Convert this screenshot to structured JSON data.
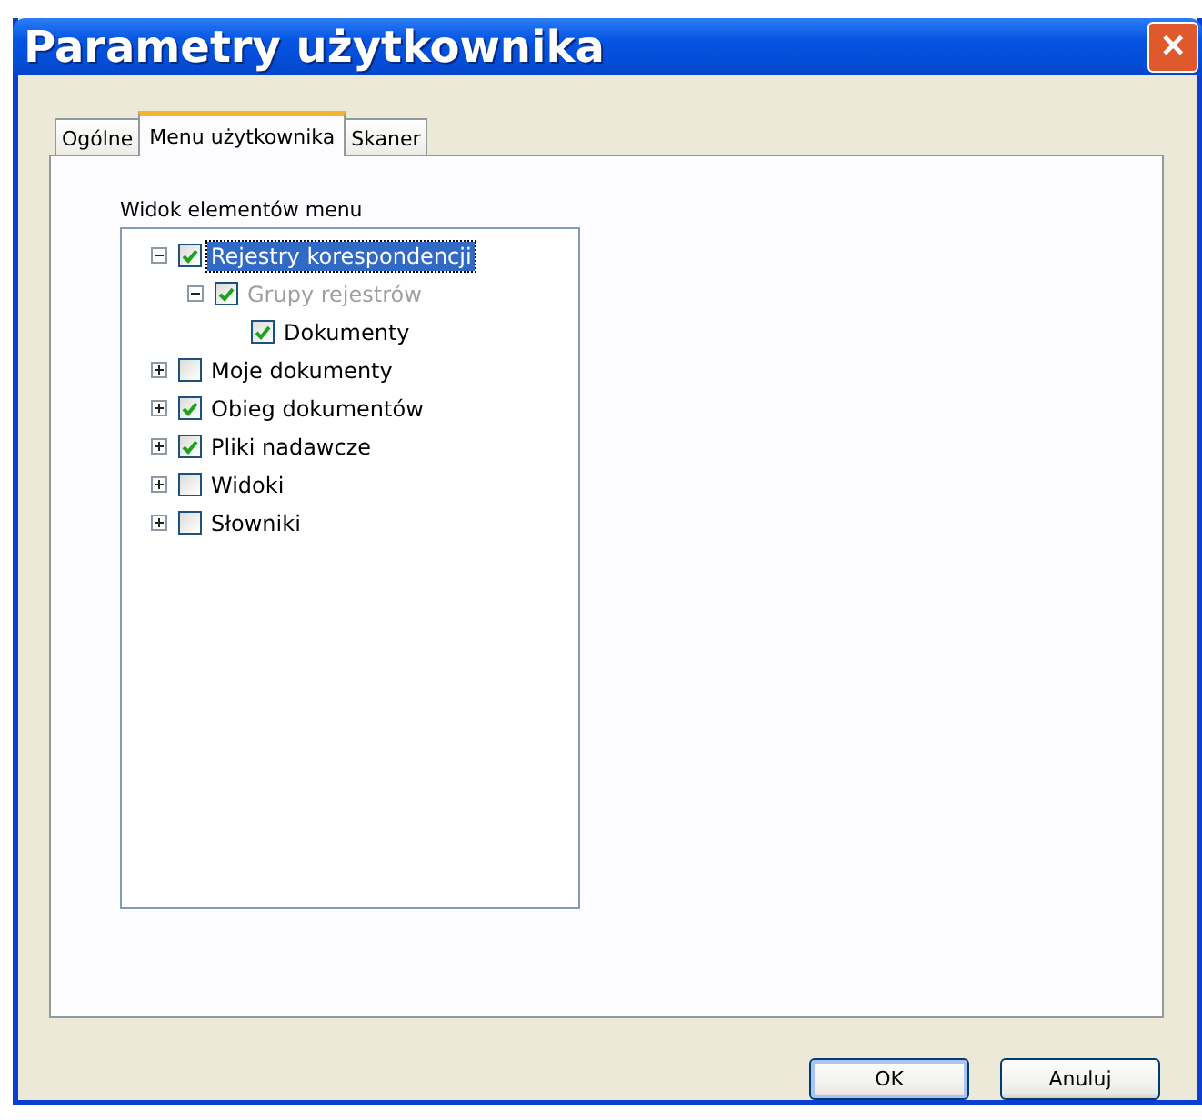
{
  "window": {
    "title": "Parametry użytkownika",
    "close": "✕"
  },
  "tabs": [
    {
      "label": "Ogólne",
      "selected": false
    },
    {
      "label": "Menu użytkownika",
      "selected": true
    },
    {
      "label": "Skaner",
      "selected": false
    }
  ],
  "tree": {
    "label": "Widok elementów menu",
    "items": [
      {
        "label": "Rejestry korespondencji",
        "checked": true,
        "selected": true,
        "disabled": false,
        "expanded": true,
        "children": [
          {
            "label": "Grupy rejestrów",
            "checked": true,
            "selected": false,
            "disabled": true,
            "expanded": true,
            "children": [
              {
                "label": "Dokumenty",
                "checked": true,
                "selected": false,
                "disabled": false
              }
            ]
          }
        ]
      },
      {
        "label": "Moje dokumenty",
        "checked": false,
        "selected": false,
        "disabled": false,
        "expanded": false
      },
      {
        "label": "Obieg dokumentów",
        "checked": true,
        "selected": false,
        "disabled": false,
        "expanded": false
      },
      {
        "label": "Pliki nadawcze",
        "checked": true,
        "selected": false,
        "disabled": false,
        "expanded": false
      },
      {
        "label": "Widoki",
        "checked": false,
        "selected": false,
        "disabled": false,
        "expanded": false
      },
      {
        "label": "Słowniki",
        "checked": false,
        "selected": false,
        "disabled": false,
        "expanded": false
      }
    ]
  },
  "buttons": [
    {
      "label": "OK",
      "kind": "default"
    },
    {
      "label": "Anuluj",
      "kind": "normal"
    }
  ]
}
